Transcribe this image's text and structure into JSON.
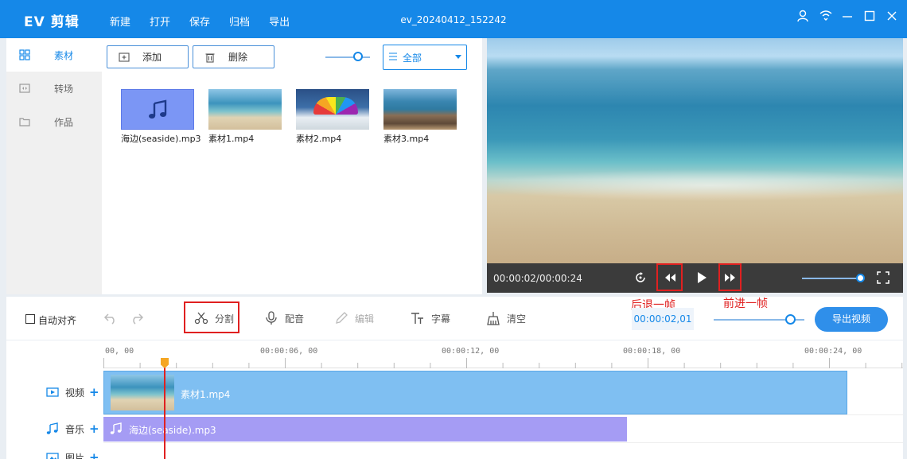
{
  "app": {
    "logo": "EV 剪辑",
    "menu": [
      "新建",
      "打开",
      "保存",
      "归档",
      "导出"
    ],
    "document_title": "ev_20240412_152242",
    "window_controls": [
      "user-icon",
      "wifi-icon",
      "minimize-icon",
      "maximize-icon",
      "close-icon"
    ]
  },
  "sidebar": {
    "items": [
      {
        "label": "素材",
        "icon": "grid-icon",
        "active": true
      },
      {
        "label": "转场",
        "icon": "transition-icon",
        "active": false
      },
      {
        "label": "作品",
        "icon": "folder-icon",
        "active": false
      }
    ]
  },
  "library": {
    "add_label": "添加",
    "delete_label": "删除",
    "filter_label": "全部",
    "items": [
      {
        "caption": "海边(seaside).mp3",
        "kind": "audio"
      },
      {
        "caption": "素材1.mp4",
        "kind": "video"
      },
      {
        "caption": "素材2.mp4",
        "kind": "video"
      },
      {
        "caption": "素材3.mp4",
        "kind": "video"
      }
    ]
  },
  "preview": {
    "timecode": "00:00:02/00:00:24",
    "volume_level": 0.95
  },
  "toolbar": {
    "auto_align_label": "自动对齐",
    "split_label": "分割",
    "dub_label": "配音",
    "edit_label": "编辑",
    "subtitle_label": "字幕",
    "clear_label": "清空",
    "annot_prev_frame": "后退一帧",
    "annot_next_frame": "前进一帧",
    "current_time": "00:00:02,01",
    "export_label": "导出视频",
    "timeline_zoom_level": 0.8
  },
  "timeline": {
    "ruler_labels": [
      "00, 00",
      "00:00:06, 00",
      "00:00:12, 00",
      "00:00:18, 00",
      "00:00:24, 00"
    ],
    "tracks": [
      {
        "label": "视频",
        "icon": "video-icon"
      },
      {
        "label": "音乐",
        "icon": "music-icon"
      },
      {
        "label": "图片",
        "icon": "image-icon"
      }
    ],
    "video_clip_label": "素材1.mp4",
    "audio_clip_label": "海边(seaside).mp3"
  },
  "colors": {
    "accent": "#1588e8",
    "highlight": "#e02020",
    "video_clip": "#7fbff2",
    "audio_clip": "#a59cf4"
  }
}
